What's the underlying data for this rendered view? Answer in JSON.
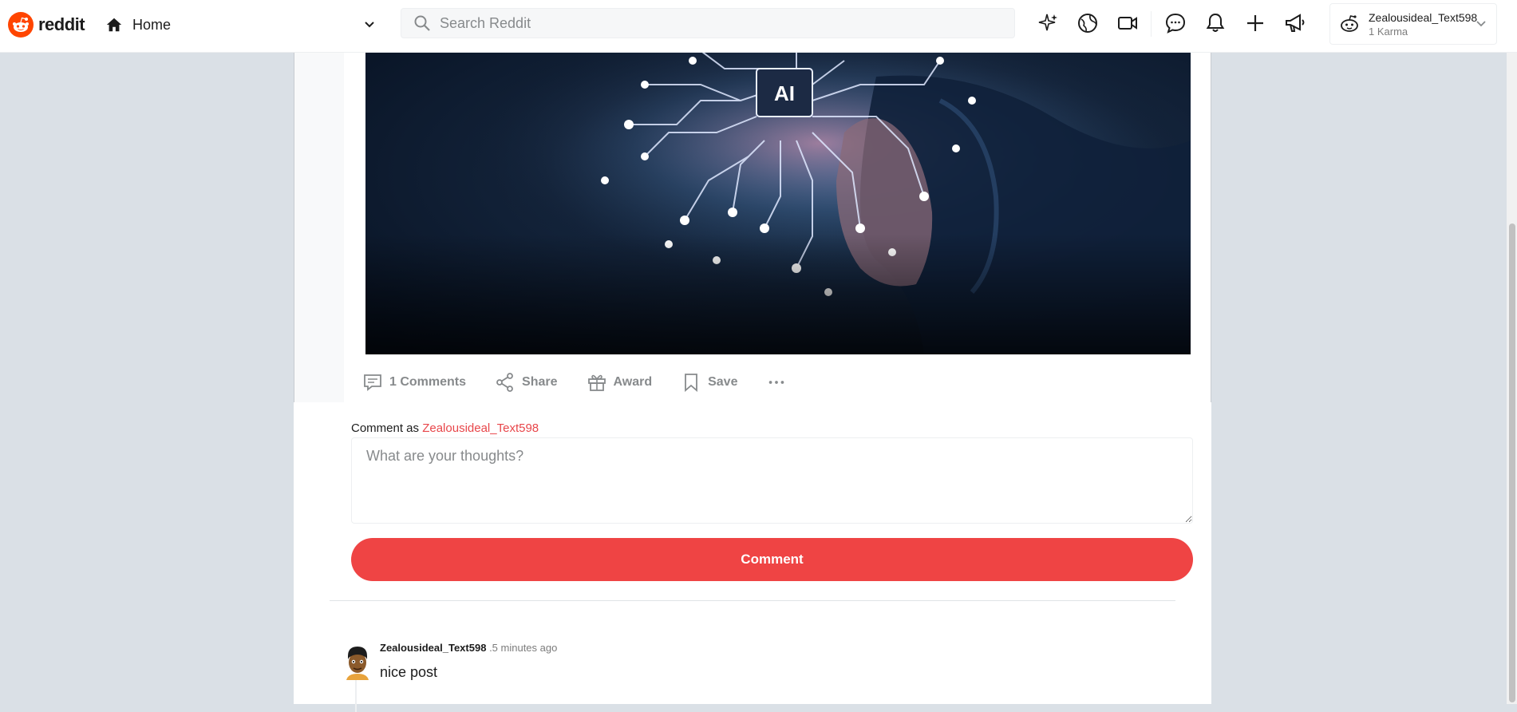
{
  "header": {
    "logo_text": "reddit",
    "home_label": "Home",
    "search_placeholder": "Search Reddit",
    "icons": [
      "sparkle-icon",
      "explore-icon",
      "video-icon",
      "chat-icon",
      "bell-icon",
      "plus-icon",
      "advertise-icon"
    ],
    "user": {
      "name": "Zealousideal_Text598",
      "karma": "1 Karma"
    }
  },
  "post": {
    "image_caption": "AI",
    "actions": {
      "comments": "1 Comments",
      "share": "Share",
      "award": "Award",
      "save": "Save"
    }
  },
  "composer": {
    "prefix": "Comment as",
    "username": "Zealousideal_Text598",
    "placeholder": "What are your thoughts?",
    "button": "Comment"
  },
  "comments": [
    {
      "author": "Zealousideal_Text598",
      "time": ".5 minutes ago",
      "body": "nice post"
    }
  ],
  "colors": {
    "brand": "#ff4500",
    "comment_button": "#ef4444",
    "username_accent": "#e8464a",
    "page_background": "#dae0e6"
  }
}
